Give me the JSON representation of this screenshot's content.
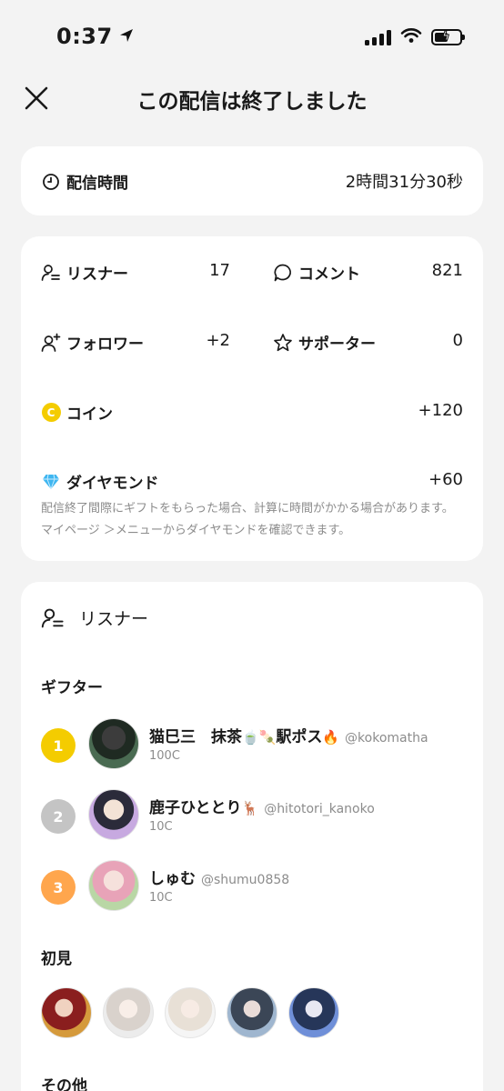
{
  "status": {
    "time": "0:37"
  },
  "nav": {
    "title": "この配信は終了しました"
  },
  "duration": {
    "label": "配信時間",
    "value": "2時間31分30秒"
  },
  "stats": {
    "listeners_label": "リスナー",
    "listeners_value": "17",
    "comments_label": "コメント",
    "comments_value": "821",
    "followers_label": "フォロワー",
    "followers_value": "+2",
    "supporters_label": "サポーター",
    "supporters_value": "0",
    "coins_label": "コイン",
    "coins_value": "+120",
    "coin_badge": "C",
    "diamonds_label": "ダイヤモンド",
    "diamonds_value": "+60",
    "note": "配信終了間際にギフトをもらった場合、計算に時間がかかる場合があります。マイページ ＞メニューからダイヤモンドを確認できます。"
  },
  "listeners_section": {
    "title": "リスナー",
    "gifters_title": "ギフター",
    "gifters": [
      {
        "rank": "1",
        "name": "猫巳三　抹茶",
        "emoji": "🍵🍡",
        "name2": "駅ポス",
        "emoji2": "🔥",
        "handle": "@kokomatha",
        "coins": "100C"
      },
      {
        "rank": "2",
        "name": "鹿子ひととり",
        "emoji": "🦌",
        "name2": "",
        "emoji2": "",
        "handle": "@hitotori_kanoko",
        "coins": "10C"
      },
      {
        "rank": "3",
        "name": "しゅむ",
        "emoji": "",
        "name2": "",
        "emoji2": "",
        "handle": "@shumu0858",
        "coins": "10C"
      }
    ],
    "first_time_title": "初見",
    "other_title": "その他"
  },
  "colors": {
    "rank1": "#f4cc00",
    "rank2": "#c4c4c4",
    "rank3": "#ffa64d",
    "coin": "#f4cc00",
    "diamond": "#3fb6f0"
  }
}
